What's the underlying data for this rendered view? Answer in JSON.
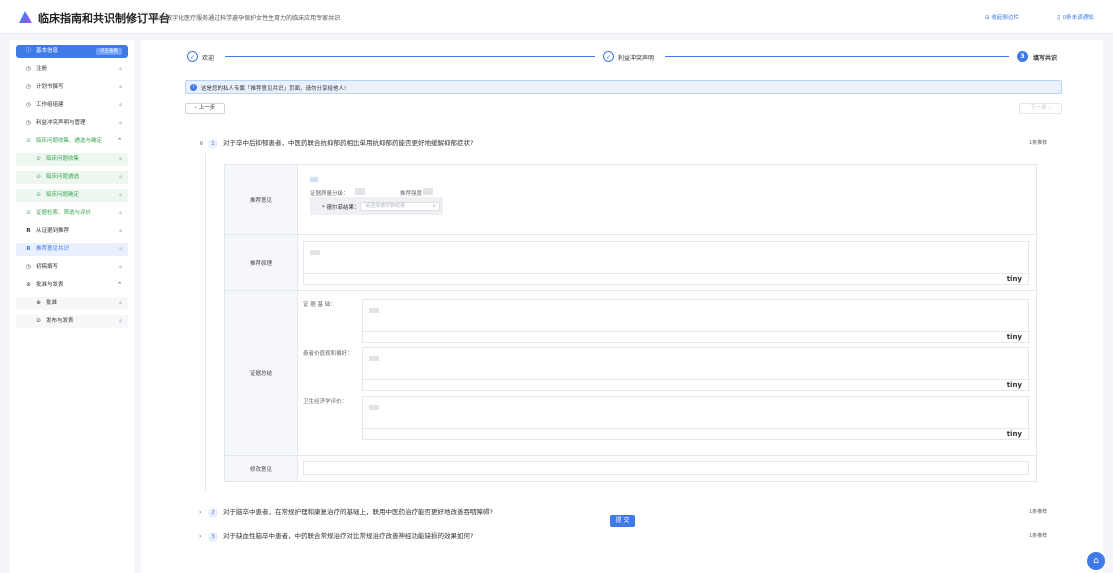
{
  "header": {
    "app_title": "临床指南和共识制修订平台",
    "project_name": "测试-数字化医疗服务通过科学避孕保护女性生育力的临床应用专家共识",
    "collapse_sidebar": "收起侧边栏",
    "notifications": "0条未读通知"
  },
  "sidebar": {
    "basic_info": "基本信息",
    "basic_info_badge": "点击查看",
    "items": [
      {
        "label": "注册"
      },
      {
        "label": "计划书撰写"
      },
      {
        "label": "工作组组建"
      },
      {
        "label": "利益冲突声明与管理"
      },
      {
        "label": "临床问题收集、遴选与确定"
      },
      {
        "label": "临床问题收集"
      },
      {
        "label": "临床问题遴选"
      },
      {
        "label": "临床问题确定"
      },
      {
        "label": "证据检索、筛选与评价"
      },
      {
        "label": "从证据到推荐"
      },
      {
        "label": "推荐意见共识"
      },
      {
        "label": "初稿撰写"
      },
      {
        "label": "批准与发表"
      },
      {
        "label": "批准"
      },
      {
        "label": "发布与发表"
      }
    ]
  },
  "steps": [
    {
      "label": "欢迎",
      "mark": "✓"
    },
    {
      "label": "利益冲突声明",
      "mark": "✓"
    },
    {
      "label": "填写共识",
      "mark": "3"
    }
  ],
  "alert_text": "这是您的私人专属「推荐意见共识」页面，请勿分享给他人!",
  "prev_button": "上一步",
  "next_button": "下一步",
  "questions": [
    {
      "num": "1",
      "text": "对于卒中后抑郁患者，中医药联合抗抑郁药相比单用抗抑郁药能否更好地缓解抑郁症状?",
      "rec": "1条推荐"
    },
    {
      "num": "2",
      "text": "对于脑卒中患者，在常规护理和康复治疗的基础上，联用中医药治疗能否更好地改善吞咽障碍?",
      "rec": "1条推荐"
    },
    {
      "num": "3",
      "text": "对于缺血性脑卒中患者，中药联合常规治疗对比常规治疗改善神经功能缺损的效果如何?",
      "rec": "1条推荐"
    }
  ],
  "form": {
    "rec_opinion_label": "推荐意见",
    "evidence_quality": "证据质量分级：",
    "rec_strength": "推荐强度：",
    "delphi_label": "* 德尔菲结果：",
    "delphi_placeholder": "请选择德尔菲结果",
    "rec_reason_label": "推荐原理",
    "evidence_summary_label": "证据总结",
    "evidence_basis": "证 据 基 础：",
    "patient_values": "患者价值观和偏好：",
    "health_econ": "卫生经济学评价：",
    "revision_label": "修改意见",
    "tiny": "tiny"
  },
  "submit_button": "提 交",
  "colors": {
    "primary": "#3f7ae6",
    "success": "#3aa654"
  }
}
